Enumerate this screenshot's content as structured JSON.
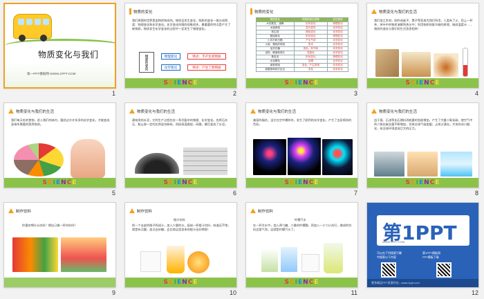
{
  "slides": [
    {
      "num": "1",
      "title": "物质变化与我们",
      "subtitle": "第一PPT模板网-WWW.1PPT.COM"
    },
    {
      "num": "2",
      "header": "物质的变化",
      "body": "我们周围的世界是由物质构成的。物质会发生变化，物质的变化一般分成两类：物理变化和化学变化。化学变化伴随的现象很多，最重要的特点是产生了新物质。物质发生化学变化的过程中一定发生了物理变化。",
      "diagram_left": "物质的变化",
      "diagram_items": [
        {
          "label": "物理变化",
          "desc": "特点：不产生新物质"
        },
        {
          "label": "化学变化",
          "desc": "特点：产生了新物质"
        }
      ],
      "footer": "SCIENCE"
    },
    {
      "num": "3",
      "header": "物质的变化",
      "table": {
        "headers": [
          "物质变化",
          "伴随的常见现象",
          "变化类型"
        ],
        "rows": [
          [
            "水的蒸发、沸腾",
            "形状变化",
            "物理变化"
          ],
          [
            "木柴燃烧",
            "发光发热",
            "化学变化"
          ],
          [
            "铁生锈",
            "颜色变化",
            "化学变化"
          ],
          [
            "蜡烛熔化",
            "形状变化",
            "物理变化"
          ],
          [
            "小苏打和白醋",
            "产生气体",
            "化学变化"
          ],
          [
            "火柴、蜡烛的燃烧",
            "发光",
            "化学变化"
          ],
          [
            "加热白糖",
            "变色、有气味",
            "化学变化"
          ],
          [
            "淀粉、碘酒和馒头",
            "变蓝色",
            "化学变化"
          ],
          [
            "橡皮泥",
            "形状变化",
            "物理变化"
          ],
          [
            "水泥硬化",
            "坚硬",
            "化学变化"
          ],
          [
            "钢铁锈蚀",
            "变色、产生铁锈",
            "化学变化"
          ],
          [
            "硫酸铜和铁钉反应",
            "变色",
            "化学变化"
          ]
        ]
      },
      "footer": "SCIENCE"
    },
    {
      "num": "4",
      "header": "物质变化与我们的生活",
      "body": "我们加工木材，制作成桌子、凳子等家具为我们所用，人类有了火、用上一杯茶，茶叶中的物质溶解到热水中；利用物质热胀冷缩的原理，制成温度计……物质的变化与我们的生活息息相关！",
      "footer": "SCIENCE"
    },
    {
      "num": "5",
      "header": "物质变化与我们的生活",
      "body": "我们每天吃的食物，进入我们的体内，要经过许许多多的化学变化，才能变成身体所需要的营养物质。",
      "footer": "SCIENCE"
    },
    {
      "num": "6",
      "header": "物质变化与我们的生活",
      "body": "建筑用的水泥，它的生产过程包含一系列复杂的物理、化学变化。先将石灰石、黏土按一定的比例混合粉碎，再经高温煅烧，研磨，最后变成了水泥。",
      "footer": "SCIENCE"
    },
    {
      "num": "7",
      "header": "物质变化与我们的生活",
      "body": "美丽的烟花，当它在空中爆炸时，发生了剧烈的化学变化，产生了五彩缤纷的色彩。",
      "footer": "SCIENCE"
    },
    {
      "num": "8",
      "header": "物质变化与我们的生活",
      "body": "由于煤、石油等化石燃料消耗量的急剧增加，产生了大量二氧化碳，使空气中的二氧化碳含量不断增加，导致全球气候变暖；土地沙漠化，大块的冰川融化，给全球环境造成巨大的压力。",
      "footer": "SCIENCE"
    },
    {
      "num": "9",
      "header": "制作饮料",
      "body": "你喜欢喝什么饮料？想自己做一杯饮料吗？"
    },
    {
      "num": "10",
      "header": "制作饮料",
      "subhead": "橙汁饮料",
      "body": "把一个去皮的橙子榨成汁，加入少量的水，配成一杯橙汁饮料，味道还不错，就是有点酸，加点白砂糖，会比商店里卖来的橙汁还好喝呢！",
      "footer": "SCIENCE"
    },
    {
      "num": "11",
      "header": "制作饮料",
      "subhead": "柠檬汽水",
      "body": "在一杯冷水中，加入两勺糖、少量的柠檬酸，再加入一小勺小苏打，做成的饮料会冒气泡，这就是柠檬汽水了。",
      "footer": "SCIENCE"
    },
    {
      "num": "12",
      "logo": "第1PPT",
      "logo_caption": "WWW.1PPT.COM",
      "lines": [
        "可以在下列搜索引擎",
        "中搜索以下内容",
        "第1PPT模板网",
        "PPT模板下载"
      ],
      "strip": "更多精品PPT资源尽在—www.1ppt.com"
    }
  ],
  "colors": {
    "accent": "#f0a020",
    "green": "#8bc34a",
    "blue": "#2a62b8",
    "selected_border": "#f0a020"
  }
}
